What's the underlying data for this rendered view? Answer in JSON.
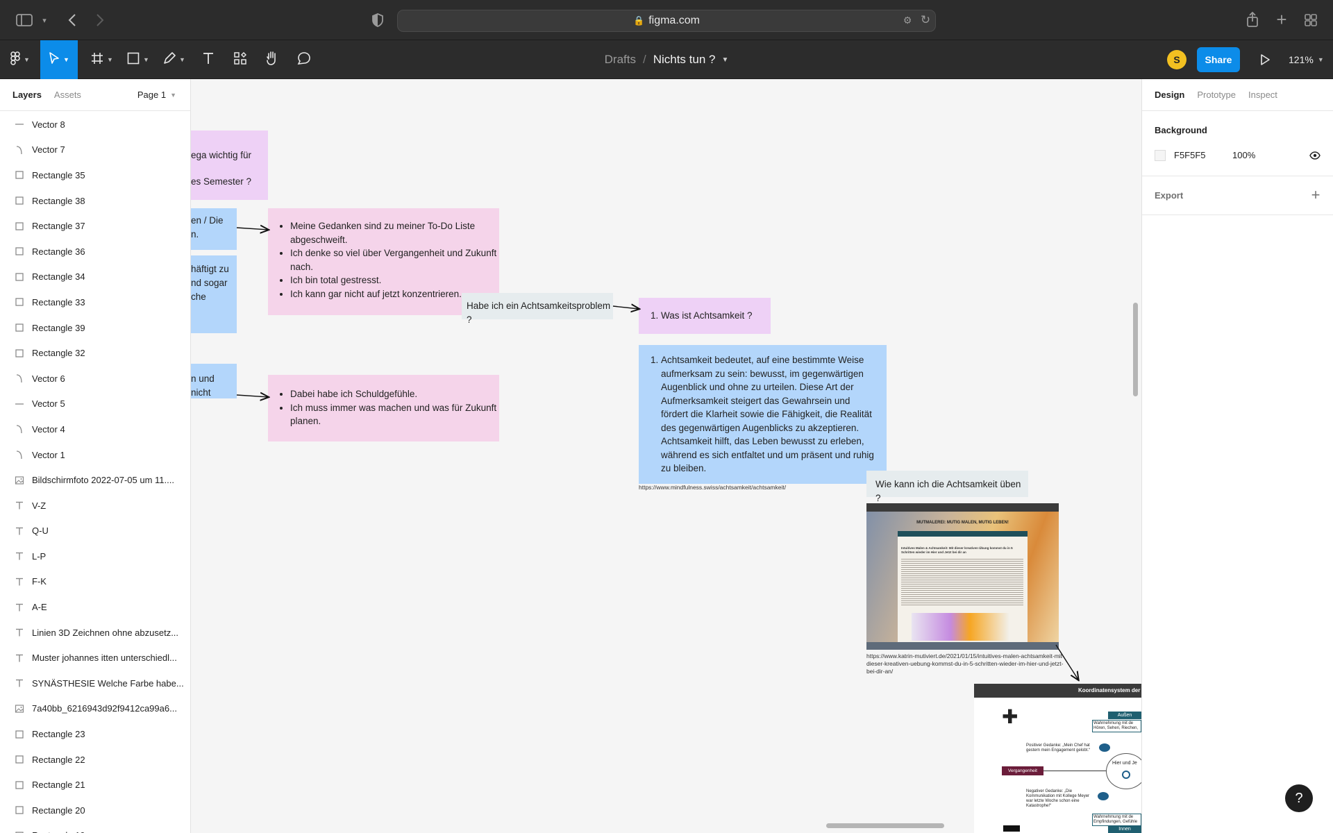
{
  "browser": {
    "url": "figma.com"
  },
  "toolbar": {
    "breadcrumb_parent": "Drafts",
    "separator": "/",
    "file_name": "Nichts tun ?",
    "avatar_initial": "S",
    "share_label": "Share",
    "zoom_level": "121%"
  },
  "left_panel": {
    "tabs": [
      "Layers",
      "Assets"
    ],
    "active_tab": "Layers",
    "page": "Page 1",
    "layers": [
      {
        "name": "Vector 8",
        "icon": "line-icon"
      },
      {
        "name": "Vector 7",
        "icon": "vector-icon"
      },
      {
        "name": "Rectangle 35",
        "icon": "rectangle-icon"
      },
      {
        "name": "Rectangle 38",
        "icon": "rectangle-icon"
      },
      {
        "name": "Rectangle 37",
        "icon": "rectangle-icon"
      },
      {
        "name": "Rectangle 36",
        "icon": "rectangle-icon"
      },
      {
        "name": "Rectangle 34",
        "icon": "rectangle-icon"
      },
      {
        "name": "Rectangle 33",
        "icon": "rectangle-icon"
      },
      {
        "name": "Rectangle 39",
        "icon": "rectangle-icon"
      },
      {
        "name": "Rectangle 32",
        "icon": "rectangle-icon"
      },
      {
        "name": "Vector 6",
        "icon": "vector-icon"
      },
      {
        "name": "Vector 5",
        "icon": "line-icon"
      },
      {
        "name": "Vector 4",
        "icon": "vector-icon"
      },
      {
        "name": "Vector 1",
        "icon": "vector-icon"
      },
      {
        "name": "Bildschirmfoto 2022-07-05 um 11....",
        "icon": "image-icon"
      },
      {
        "name": "V-Z",
        "icon": "text-icon"
      },
      {
        "name": "Q-U",
        "icon": "text-icon"
      },
      {
        "name": "L-P",
        "icon": "text-icon"
      },
      {
        "name": "F-K",
        "icon": "text-icon"
      },
      {
        "name": "A-E",
        "icon": "text-icon"
      },
      {
        "name": "Linien 3D Zeichnen ohne abzusetz...",
        "icon": "text-icon"
      },
      {
        "name": "Muster johannes itten unterschiedl...",
        "icon": "text-icon"
      },
      {
        "name": "SYNÄSTHESIE Welche Farbe habe...",
        "icon": "text-icon"
      },
      {
        "name": "7a40bb_6216943d92f9412ca99a6...",
        "icon": "image-icon"
      },
      {
        "name": "Rectangle 23",
        "icon": "rectangle-icon"
      },
      {
        "name": "Rectangle 22",
        "icon": "rectangle-icon"
      },
      {
        "name": "Rectangle 21",
        "icon": "rectangle-icon"
      },
      {
        "name": "Rectangle 20",
        "icon": "rectangle-icon"
      },
      {
        "name": "Rectangle 19",
        "icon": "rectangle-icon"
      }
    ]
  },
  "right_panel": {
    "tabs": [
      "Design",
      "Prototype",
      "Inspect"
    ],
    "active_tab": "Design",
    "background_label": "Background",
    "background_hex": "F5F5F5",
    "background_opacity": "100%",
    "export_label": "Export"
  },
  "canvas": {
    "note_top_line1": "ega wichtig für",
    "note_top_line2": "es Semester ?",
    "note_blue1_line1": "en / Die",
    "note_blue1_line2": "n.",
    "note_blue2_line1": "häftigt zu",
    "note_blue2_line2": "nd sogar",
    "note_blue2_line3": "che",
    "note_blue3_line1": "n und nicht",
    "thoughts": [
      "Meine Gedanken sind zu meiner To-Do Liste abgeschweift.",
      "Ich denke so viel über Vergangenheit und Zukunft nach.",
      "Ich bin total gestresst.",
      "Ich kann gar nicht auf jetzt konzentrieren."
    ],
    "feelings": [
      "Dabei habe ich Schuldgefühle.",
      "Ich muss immer was machen und was für Zukunft planen."
    ],
    "question_problem": "Habe ich ein Achtsamkeitsproblem ?",
    "question_what": "Was ist Achtsamkeit ?",
    "definition": "Achtsamkeit bedeutet, auf eine bestimmte Weise aufmerksam zu sein: bewusst, im gegenwärtigen Augenblick und ohne zu urteilen. Diese Art der Aufmerksamkeit steigert das Gewahrsein und fördert die Klarheit sowie die Fähigkeit, die Realität des gegenwärtigen Augenblicks zu akzeptieren. Achtsamkeit hilft, das Leben bewusst zu erleben, während es sich entfaltet und um präsent und ruhig zu bleiben.",
    "definition_source": "https://www.mindfulness.swiss/achtsamkeit/achtsamkeit/",
    "question_practice": "Wie kann ich die Achtsamkeit üben ?",
    "screenshot_banner": "MUTMALEREI: MUTIG MALEN, MUTIG LEBEN!",
    "screenshot_heading": "Intuitives Malen & Achtsamkeit: Mit dieser kreativen Übung kommst du in 5 Schritten wieder im Hier und Jetzt bei dir an",
    "screenshot_source": "https://www.katrin-mutiviert.de/2021/01/15/intuitives-malen-achtsamkeit-mit-dieser-kreativen-uebung-kommst-du-in-5-schritten-wieder-im-hier-und-jetzt-bei-dir-an/",
    "diagram_title": "Koordinatensystem der",
    "diagram_aussen": "Außen",
    "diagram_aussen_note": "Wahrnehmung mit de Hören, Sehen, Riechen,",
    "diagram_positive": "Positiver Gedanke: „Mein Chef hat gestern mein Engagement gelobt.“",
    "diagram_here": "Hier und Je",
    "diagram_past": "Vergangenheit",
    "diagram_negative": "Negativer Gedanke: „Die Kommunikation mit Kollege Meyer war letzte Woche schon eine Katastrophe!“",
    "diagram_innen_note": "Wahrnehmung mit de Empfindungen, Gefühle",
    "diagram_innen": "Innen"
  },
  "help_label": "?"
}
